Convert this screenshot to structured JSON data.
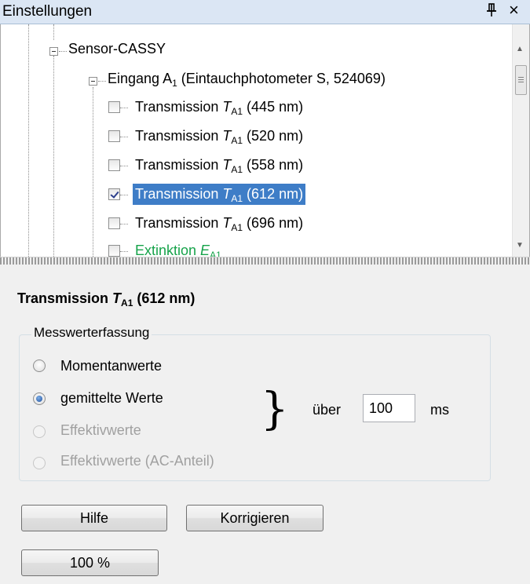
{
  "window": {
    "title": "Einstellungen",
    "pin_glyph": "ꟷ",
    "close_glyph": "×"
  },
  "tree": {
    "root": "Sensor-CASSY",
    "input": {
      "prefix": "Eingang A",
      "sub": "1",
      "suffix": " (Eintauchphotometer S, 524069)"
    },
    "items": [
      {
        "prefix": "Transmission ",
        "symbol": "T",
        "sub": "A1",
        "suffix": " (445 nm)",
        "checked": false,
        "selected": false
      },
      {
        "prefix": "Transmission ",
        "symbol": "T",
        "sub": "A1",
        "suffix": " (520 nm)",
        "checked": false,
        "selected": false
      },
      {
        "prefix": "Transmission ",
        "symbol": "T",
        "sub": "A1",
        "suffix": " (558 nm)",
        "checked": false,
        "selected": false
      },
      {
        "prefix": "Transmission ",
        "symbol": "T",
        "sub": "A1",
        "suffix": " (612 nm)",
        "checked": true,
        "selected": true
      },
      {
        "prefix": "Transmission ",
        "symbol": "T",
        "sub": "A1",
        "suffix": " (696 nm)",
        "checked": false,
        "selected": false
      },
      {
        "prefix": "Extinktion ",
        "symbol": "E",
        "sub": "A1",
        "suffix": "",
        "checked": false,
        "selected": false
      }
    ],
    "scroll_up_glyph": "▲",
    "scroll_down_glyph": "▼"
  },
  "properties": {
    "title_prefix": "Transmission ",
    "title_symbol": "T",
    "title_sub": "A1",
    "title_suffix": " (612 nm)",
    "group_label": "Messwerterfassung",
    "radios": [
      {
        "label": "Momentanwerte",
        "checked": false,
        "enabled": true
      },
      {
        "label": "gemittelte Werte",
        "checked": true,
        "enabled": true
      },
      {
        "label": "Effektivwerte",
        "checked": false,
        "enabled": false
      },
      {
        "label": "Effektivwerte (AC-Anteil)",
        "checked": false,
        "enabled": false
      }
    ],
    "brace": "}",
    "over_label": "über",
    "over_value": "100",
    "unit": "ms",
    "buttons": {
      "help": "Hilfe",
      "correct": "Korrigieren",
      "percent": "100 %"
    }
  }
}
